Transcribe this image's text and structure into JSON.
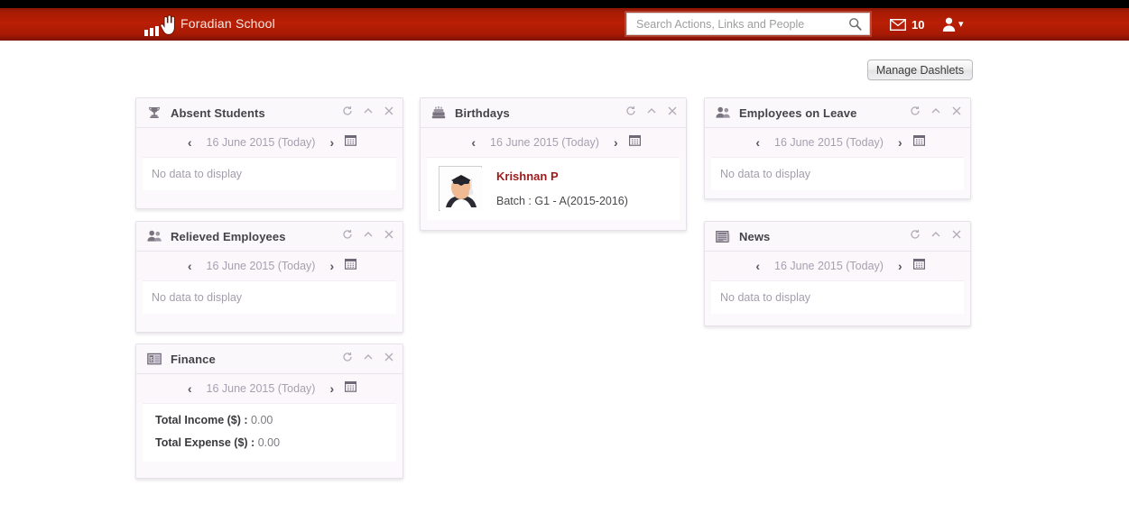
{
  "header": {
    "brand": "Foradian School",
    "logo_icon": "bars-logo-icon",
    "cursor_icon": "hand-cursor-icon",
    "search": {
      "placeholder": "Search Actions, Links and People",
      "value": "",
      "icon": "search-icon"
    },
    "mail": {
      "icon": "envelope-icon",
      "count": "10"
    },
    "user": {
      "icon": "user-icon",
      "caret": "▾"
    },
    "colors": {
      "bar_top": "#8e1604",
      "bar_mid": "#b91f05",
      "bar_bottom": "#7e1303",
      "strip": "#000000"
    }
  },
  "toolbar": {
    "manage_dashlets_label": "Manage Dashlets"
  },
  "common": {
    "date_label": "16 June 2015 (Today)",
    "prev_arrow": "‹",
    "next_arrow": "›",
    "calendar_icon": "calendar-icon",
    "refresh_icon": "refresh-icon",
    "collapse_icon": "chevron-up-icon",
    "close_icon": "close-icon",
    "no_data": "No data to display"
  },
  "dashlets": {
    "absent_students": {
      "title": "Absent Students",
      "icon": "trophy-icon",
      "date_label": "16 June 2015 (Today)",
      "body_text": "No data to display"
    },
    "relieved_employees": {
      "title": "Relieved Employees",
      "icon": "people-icon",
      "date_label": "16 June 2015 (Today)",
      "body_text": "No data to display"
    },
    "finance": {
      "title": "Finance",
      "icon": "money-icon",
      "date_label": "16 June 2015 (Today)",
      "income_label": "Total Income ($) :",
      "income_value": "0.00",
      "expense_label": "Total Expense ($) :",
      "expense_value": "0.00"
    },
    "birthdays": {
      "title": "Birthdays",
      "icon": "cake-icon",
      "date_label": "16 June 2015 (Today)",
      "person": {
        "avatar_icon": "student-avatar",
        "name": "Krishnan P",
        "batch": "Batch : G1 - A(2015-2016)"
      }
    },
    "employees_on_leave": {
      "title": "Employees on Leave",
      "icon": "people-icon",
      "date_label": "16 June 2015 (Today)",
      "body_text": "No data to display"
    },
    "news": {
      "title": "News",
      "icon": "newspaper-icon",
      "date_label": "16 June 2015 (Today)",
      "body_text": "No data to display"
    }
  }
}
